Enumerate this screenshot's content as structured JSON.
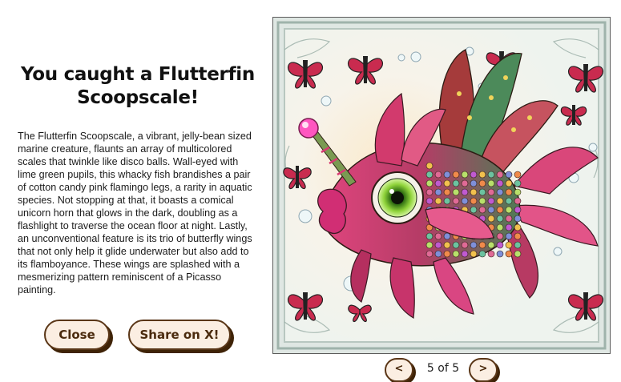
{
  "modal": {
    "title": "You caught a Flutterfin Scoopscale!",
    "description": "The Flutterfin Scoopscale, a vibrant, jelly-bean sized marine creature, flaunts an array of multicolored scales that twinkle like disco balls. Wall-eyed with lime green pupils, this whacky fish brandishes a pair of cotton candy pink flamingo legs, a rarity in aquatic species. Not stopping at that, it boasts a comical unicorn horn that glows in the dark, doubling as a flashlight to traverse the ocean floor at night. Lastly, an unconventional feature is its trio of butterfly wings that not only help it glide underwater but also add to its flamboyance. These wings are splashed with a mesmerizing pattern reminiscent of a Picasso painting.",
    "close_label": "Close",
    "share_label": "Share on X!"
  },
  "image": {
    "subject": "Flutterfin Scoopscale illustration"
  },
  "pager": {
    "prev_label": "<",
    "next_label": ">",
    "count_text": "5 of 5"
  },
  "colors": {
    "button_bg": "#fbeee2",
    "button_border": "#5a3617",
    "button_shadow": "#3f2307",
    "button_text": "#4a2a0d"
  }
}
